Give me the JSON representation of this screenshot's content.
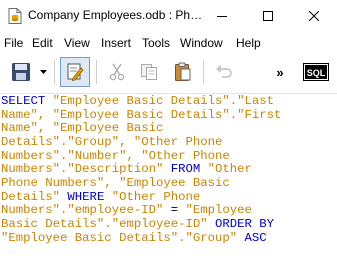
{
  "window": {
    "title": "Company Employees.odb : Ph…",
    "icons": {
      "app": "database-document-icon",
      "minimize": "minimize-icon",
      "maximize": "maximize-icon",
      "close": "close-icon"
    }
  },
  "menu": [
    "File",
    "Edit",
    "View",
    "Insert",
    "Tools",
    "Window",
    "Help"
  ],
  "toolbar": {
    "icons": [
      "save-icon",
      "dropdown-arrow-icon",
      "edit-mode-icon",
      "cut-icon",
      "copy-icon",
      "paste-icon",
      "undo-icon",
      "more-overflow-icon",
      "sql-icon"
    ],
    "more_label": "»",
    "sql_label": "SQL"
  },
  "colors": {
    "keyword": "#0000cc",
    "string": "#c98500",
    "plain": "#000000",
    "edit_active_bg": "#dde8f5"
  },
  "sql_lines": [
    [
      {
        "t": "SELECT ",
        "c": "kw"
      },
      {
        "t": "\"Employee Basic Details\".\"Last",
        "c": "str"
      }
    ],
    [
      {
        "t": "Name\", \"Employee Basic Details\".\"First",
        "c": "str"
      }
    ],
    [
      {
        "t": "Name\", \"Employee Basic",
        "c": "str"
      }
    ],
    [
      {
        "t": "Details\".\"Group\", \"Other Phone",
        "c": "str"
      }
    ],
    [
      {
        "t": "Numbers\".\"Number\", \"Other Phone",
        "c": "str"
      }
    ],
    [
      {
        "t": "Numbers\".\"Description\" ",
        "c": "str"
      },
      {
        "t": "FROM ",
        "c": "kw"
      },
      {
        "t": "\"Other",
        "c": "str"
      }
    ],
    [
      {
        "t": "Phone Numbers\", \"Employee Basic",
        "c": "str"
      }
    ],
    [
      {
        "t": "Details\" ",
        "c": "str"
      },
      {
        "t": "WHERE ",
        "c": "kw"
      },
      {
        "t": "\"Other Phone",
        "c": "str"
      }
    ],
    [
      {
        "t": "Numbers\".\"employee-ID\" ",
        "c": "str"
      },
      {
        "t": "= ",
        "c": "pl"
      },
      {
        "t": "\"Employee",
        "c": "str"
      }
    ],
    [
      {
        "t": "Basic Details\".\"employee-ID\" ",
        "c": "str"
      },
      {
        "t": "ORDER BY",
        "c": "kw"
      }
    ],
    [
      {
        "t": "\"Employee Basic Details\".\"Group\" ",
        "c": "str"
      },
      {
        "t": "ASC",
        "c": "kw"
      }
    ]
  ]
}
